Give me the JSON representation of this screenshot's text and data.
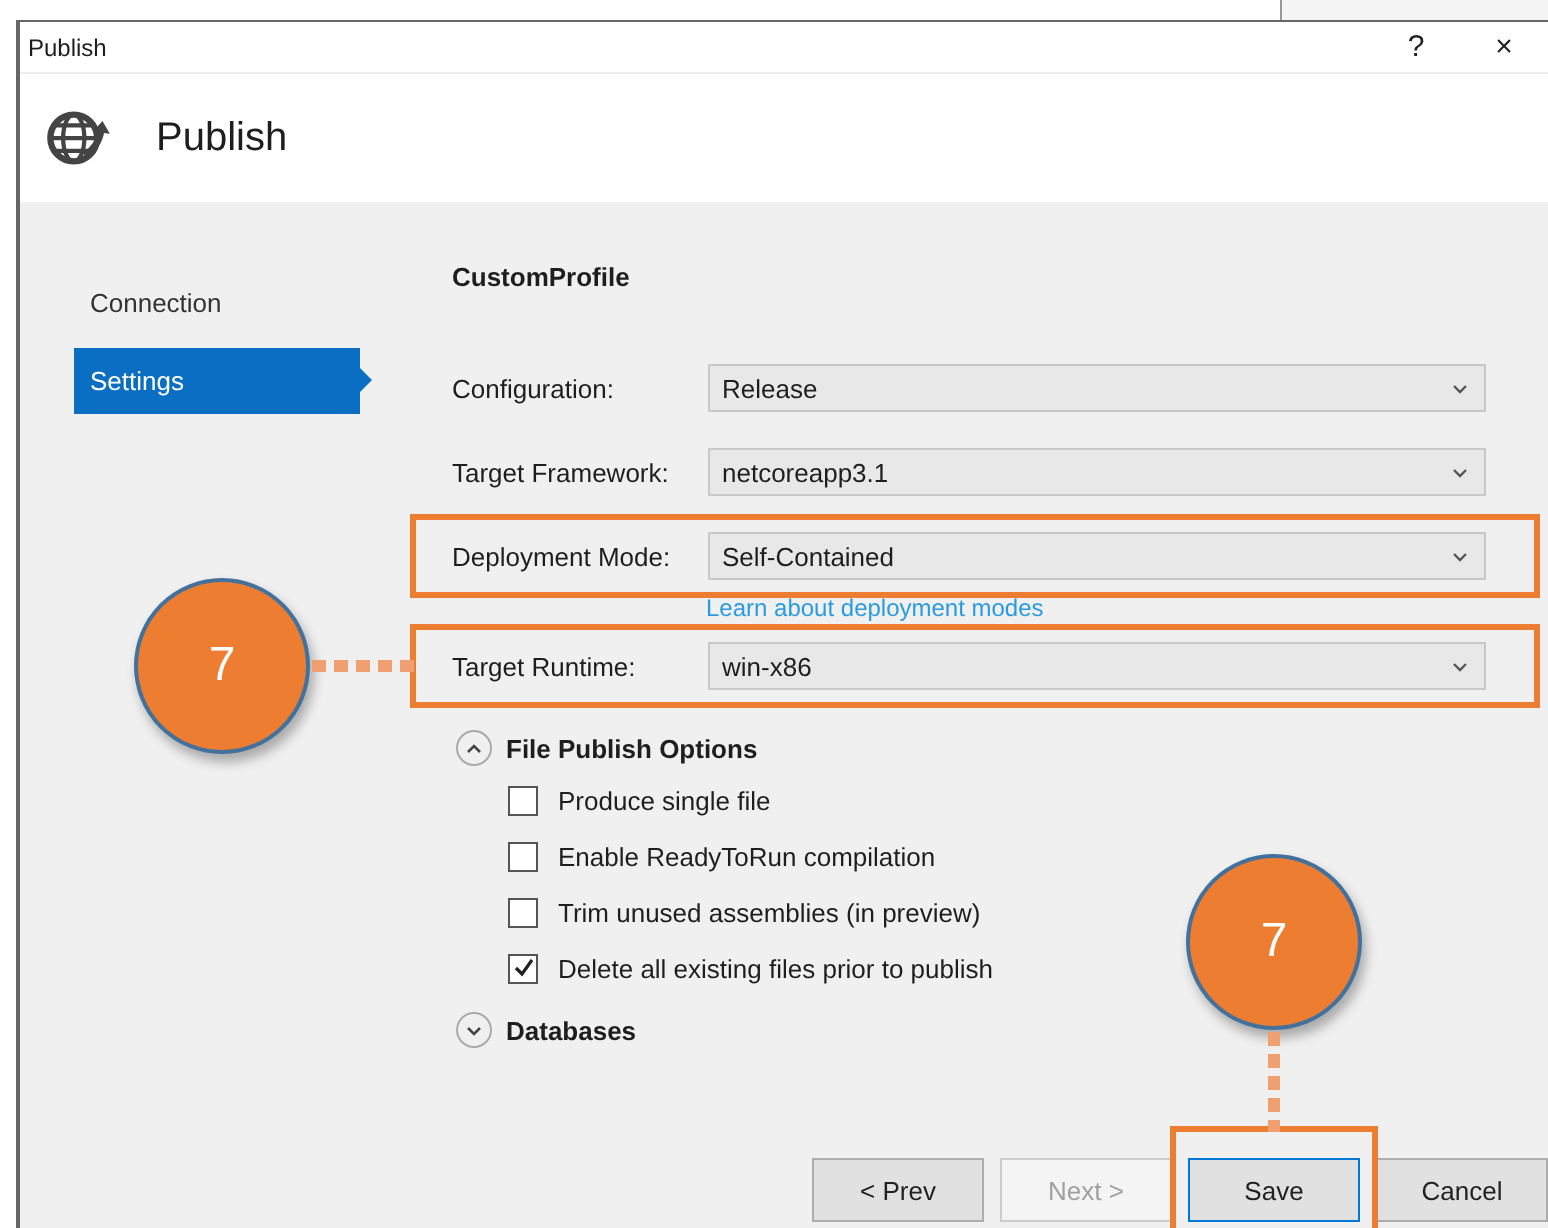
{
  "window": {
    "title": "Publish",
    "help": "?",
    "close": "×"
  },
  "header": {
    "title": "Publish"
  },
  "sidebar": {
    "items": [
      {
        "label": "Connection",
        "selected": false
      },
      {
        "label": "Settings",
        "selected": true
      }
    ]
  },
  "profile": {
    "title": "CustomProfile"
  },
  "fields": [
    {
      "label": "Configuration:",
      "value": "Release",
      "highlighted": false
    },
    {
      "label": "Target Framework:",
      "value": "netcoreapp3.1",
      "highlighted": false
    },
    {
      "label": "Deployment Mode:",
      "value": "Self-Contained",
      "highlighted": true,
      "link": "Learn about deployment modes"
    },
    {
      "label": "Target Runtime:",
      "value": "win-x86",
      "highlighted": true,
      "callout": "7"
    }
  ],
  "sections": [
    {
      "title": "File Publish Options",
      "expanded": true,
      "options": [
        {
          "label": "Produce single file",
          "checked": false
        },
        {
          "label": "Enable ReadyToRun compilation",
          "checked": false
        },
        {
          "label": "Trim unused assemblies (in preview)",
          "checked": false
        },
        {
          "label": "Delete all existing files prior to publish",
          "checked": true
        }
      ]
    },
    {
      "title": "Databases",
      "expanded": false
    }
  ],
  "buttons": [
    {
      "label": "< Prev",
      "disabled": false,
      "focused": false,
      "highlighted": false
    },
    {
      "label": "Next >",
      "disabled": true,
      "focused": false,
      "highlighted": false
    },
    {
      "label": "Save",
      "disabled": false,
      "focused": true,
      "highlighted": true,
      "callout": "7"
    },
    {
      "label": "Cancel",
      "disabled": false,
      "focused": false,
      "highlighted": false
    }
  ]
}
